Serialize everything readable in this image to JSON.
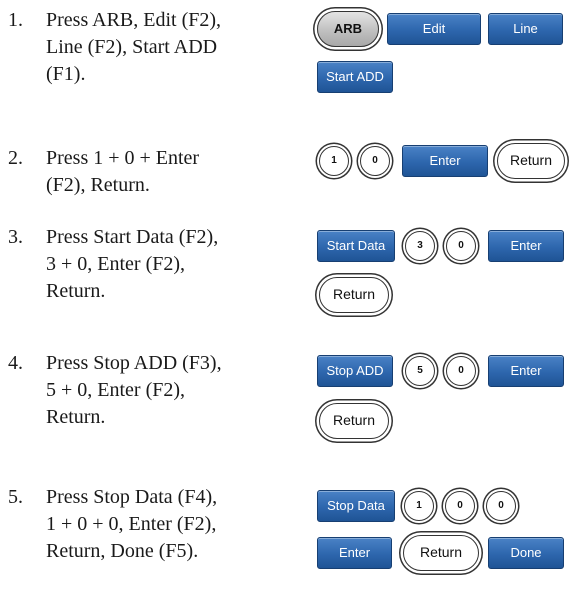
{
  "steps": [
    {
      "number": "1.",
      "text": "Press ARB, Edit (F2),\nLine (F2), Start ADD\n(F1).",
      "keys": {
        "arb": "ARB",
        "edit": "Edit",
        "line": "Line",
        "start_add": "Start ADD"
      }
    },
    {
      "number": "2.",
      "text": "Press 1 + 0 + Enter\n(F2), Return.",
      "keys": {
        "d1": "1",
        "d2": "0",
        "enter": "Enter",
        "return": "Return"
      }
    },
    {
      "number": "3.",
      "text": "Press Start Data (F2),\n3 + 0, Enter (F2),\nReturn.",
      "keys": {
        "start_data": "Start Data",
        "d1": "3",
        "d2": "0",
        "enter": "Enter",
        "return": "Return"
      }
    },
    {
      "number": "4.",
      "text": "Press Stop ADD (F3),\n5 + 0, Enter (F2),\nReturn.",
      "keys": {
        "stop_add": "Stop ADD",
        "d1": "5",
        "d2": "0",
        "enter": "Enter",
        "return": "Return"
      }
    },
    {
      "number": "5.",
      "text": "Press Stop Data (F4),\n1 + 0 + 0, Enter (F2),\nReturn, Done (F5).",
      "keys": {
        "stop_data": "Stop Data",
        "d1": "1",
        "d2": "0",
        "d3": "0",
        "enter": "Enter",
        "return": "Return",
        "done": "Done"
      }
    }
  ]
}
